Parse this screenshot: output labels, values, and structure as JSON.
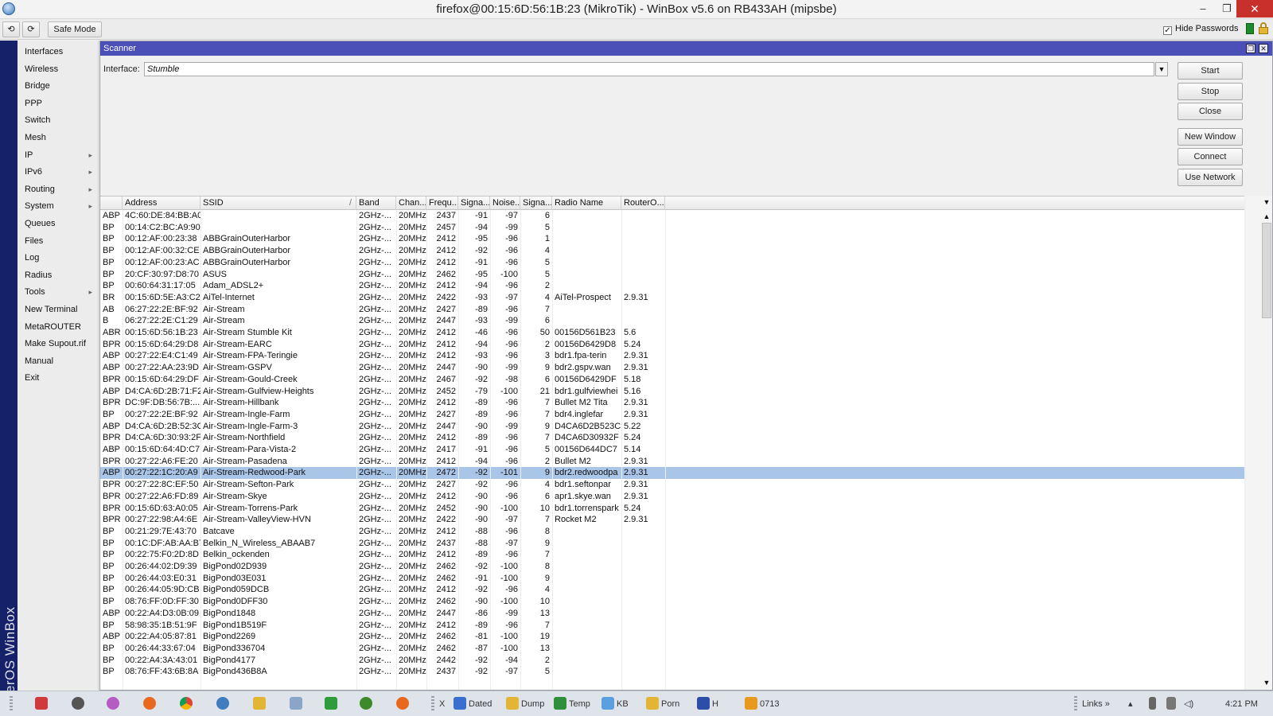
{
  "window": {
    "title": "firefox@00:15:6D:56:1B:23 (MikroTik) - WinBox v5.6 on RB433AH (mipsbe)",
    "minimize": "–",
    "restore": "❐",
    "close": "✕"
  },
  "toolbar": {
    "undo": "⟲",
    "redo": "⟳",
    "safe_mode": "Safe Mode",
    "hide_passwords_label": "Hide Passwords",
    "hide_passwords_checked": "✓"
  },
  "brand": "RouterOS WinBox",
  "sidebar": {
    "items": [
      {
        "label": "Interfaces",
        "arrow": ""
      },
      {
        "label": "Wireless",
        "arrow": ""
      },
      {
        "label": "Bridge",
        "arrow": ""
      },
      {
        "label": "PPP",
        "arrow": ""
      },
      {
        "label": "Switch",
        "arrow": ""
      },
      {
        "label": "Mesh",
        "arrow": ""
      },
      {
        "label": "IP",
        "arrow": "▸"
      },
      {
        "label": "IPv6",
        "arrow": "▸"
      },
      {
        "label": "Routing",
        "arrow": "▸"
      },
      {
        "label": "System",
        "arrow": "▸"
      },
      {
        "label": "Queues",
        "arrow": ""
      },
      {
        "label": "Files",
        "arrow": ""
      },
      {
        "label": "Log",
        "arrow": ""
      },
      {
        "label": "Radius",
        "arrow": ""
      },
      {
        "label": "Tools",
        "arrow": "▸"
      },
      {
        "label": "New Terminal",
        "arrow": ""
      },
      {
        "label": "MetaROUTER",
        "arrow": ""
      },
      {
        "label": "Make Supout.rif",
        "arrow": ""
      },
      {
        "label": "Manual",
        "arrow": ""
      },
      {
        "label": "Exit",
        "arrow": ""
      }
    ]
  },
  "scanner": {
    "title": "Scanner",
    "restore_btn": "❐",
    "close_btn": "✕",
    "interface_label": "Interface:",
    "interface_value": "Stumble",
    "interface_dropdown": "▼",
    "buttons": [
      "Start",
      "Stop",
      "Close",
      "New Window",
      "Connect",
      "Use Network"
    ],
    "columns": [
      "",
      "Address",
      "SSID",
      "Band",
      "Chan...",
      "Frequ...",
      "Signa...",
      "Noise...",
      "Signa...",
      "Radio Name",
      "RouterO..."
    ],
    "sort_indicator": "/",
    "rows": [
      [
        "ABP",
        "4C:60:DE:84:BB:A0",
        "",
        "2GHz-...",
        "20MHz",
        "2437",
        "-91",
        "-97",
        "6",
        "",
        ""
      ],
      [
        "BP",
        "00:14:C2:BC:A9:90",
        "",
        "2GHz-...",
        "20MHz",
        "2457",
        "-94",
        "-99",
        "5",
        "",
        ""
      ],
      [
        "BP",
        "00:12:AF:00:23:38",
        "ABBGrainOuterHarbor",
        "2GHz-...",
        "20MHz",
        "2412",
        "-95",
        "-96",
        "1",
        "",
        ""
      ],
      [
        "BP",
        "00:12:AF:00:32:CE",
        "ABBGrainOuterHarbor",
        "2GHz-...",
        "20MHz",
        "2412",
        "-92",
        "-96",
        "4",
        "",
        ""
      ],
      [
        "BP",
        "00:12:AF:00:23:AC",
        "ABBGrainOuterHarbor",
        "2GHz-...",
        "20MHz",
        "2412",
        "-91",
        "-96",
        "5",
        "",
        ""
      ],
      [
        "BP",
        "20:CF:30:97:D8:70",
        "ASUS",
        "2GHz-...",
        "20MHz",
        "2462",
        "-95",
        "-100",
        "5",
        "",
        ""
      ],
      [
        "BP",
        "00:60:64:31:17:05",
        "Adam_ADSL2+",
        "2GHz-...",
        "20MHz",
        "2412",
        "-94",
        "-96",
        "2",
        "",
        ""
      ],
      [
        "BR",
        "00:15:6D:5E:A3:C2",
        "AiTel-Internet",
        "2GHz-...",
        "20MHz",
        "2422",
        "-93",
        "-97",
        "4",
        "AiTel-Prospect",
        "2.9.31"
      ],
      [
        "AB",
        "06:27:22:2E:BF:92",
        "Air-Stream",
        "2GHz-...",
        "20MHz",
        "2427",
        "-89",
        "-96",
        "7",
        "",
        ""
      ],
      [
        "B",
        "06:27:22:2E:C1:29",
        "Air-Stream",
        "2GHz-...",
        "20MHz",
        "2447",
        "-93",
        "-99",
        "6",
        "",
        ""
      ],
      [
        "ABR",
        "00:15:6D:56:1B:23",
        "Air-Stream Stumble Kit",
        "2GHz-...",
        "20MHz",
        "2412",
        "-46",
        "-96",
        "50",
        "00156D561B23",
        "5.6"
      ],
      [
        "BPR",
        "00:15:6D:64:29:D8",
        "Air-Stream-EARC",
        "2GHz-...",
        "20MHz",
        "2412",
        "-94",
        "-96",
        "2",
        "00156D6429D8",
        "5.24"
      ],
      [
        "ABP",
        "00:27:22:E4:C1:49",
        "Air-Stream-FPA-Teringie",
        "2GHz-...",
        "20MHz",
        "2412",
        "-93",
        "-96",
        "3",
        "bdr1.fpa-terin",
        "2.9.31"
      ],
      [
        "ABP",
        "00:27:22:AA:23:9D",
        "Air-Stream-GSPV",
        "2GHz-...",
        "20MHz",
        "2447",
        "-90",
        "-99",
        "9",
        "bdr2.gspv.wan",
        "2.9.31"
      ],
      [
        "BPR",
        "00:15:6D:64:29:DF",
        "Air-Stream-Gould-Creek",
        "2GHz-...",
        "20MHz",
        "2467",
        "-92",
        "-98",
        "6",
        "00156D6429DF",
        "5.18"
      ],
      [
        "ABP",
        "D4:CA:6D:2B:71:F2",
        "Air-Stream-Gulfview-Heights",
        "2GHz-...",
        "20MHz",
        "2452",
        "-79",
        "-100",
        "21",
        "bdr1.gulfviewhei",
        "5.16"
      ],
      [
        "BPR",
        "DC:9F:DB:56:7B:...",
        "Air-Stream-Hillbank",
        "2GHz-...",
        "20MHz",
        "2412",
        "-89",
        "-96",
        "7",
        "Bullet M2 Tita",
        "2.9.31"
      ],
      [
        "BP",
        "00:27:22:2E:BF:92",
        "Air-Stream-Ingle-Farm",
        "2GHz-...",
        "20MHz",
        "2427",
        "-89",
        "-96",
        "7",
        "bdr4.inglefar",
        "2.9.31"
      ],
      [
        "ABP",
        "D4:CA:6D:2B:52:3C",
        "Air-Stream-Ingle-Farm-3",
        "2GHz-...",
        "20MHz",
        "2447",
        "-90",
        "-99",
        "9",
        "D4CA6D2B523C",
        "5.22"
      ],
      [
        "BPR",
        "D4:CA:6D:30:93:2F",
        "Air-Stream-Northfield",
        "2GHz-...",
        "20MHz",
        "2412",
        "-89",
        "-96",
        "7",
        "D4CA6D30932F",
        "5.24"
      ],
      [
        "ABP",
        "00:15:6D:64:4D:C7",
        "Air-Stream-Para-Vista-2",
        "2GHz-...",
        "20MHz",
        "2417",
        "-91",
        "-96",
        "5",
        "00156D644DC7",
        "5.14"
      ],
      [
        "BPR",
        "00:27:22:A6:FE:20",
        "Air-Stream-Pasadena",
        "2GHz-...",
        "20MHz",
        "2412",
        "-94",
        "-96",
        "2",
        "Bullet M2",
        "2.9.31"
      ],
      [
        "ABP",
        "00:27:22:1C:20:A9",
        "Air-Stream-Redwood-Park",
        "2GHz-...",
        "20MHz",
        "2472",
        "-92",
        "-101",
        "9",
        "bdr2.redwoodpa",
        "2.9.31"
      ],
      [
        "BPR",
        "00:27:22:8C:EF:50",
        "Air-Stream-Sefton-Park",
        "2GHz-...",
        "20MHz",
        "2427",
        "-92",
        "-96",
        "4",
        "bdr1.seftonpar",
        "2.9.31"
      ],
      [
        "BPR",
        "00:27:22:A6:FD:89",
        "Air-Stream-Skye",
        "2GHz-...",
        "20MHz",
        "2412",
        "-90",
        "-96",
        "6",
        "apr1.skye.wan",
        "2.9.31"
      ],
      [
        "BPR",
        "00:15:6D:63:A0:05",
        "Air-Stream-Torrens-Park",
        "2GHz-...",
        "20MHz",
        "2452",
        "-90",
        "-100",
        "10",
        "bdr1.torrenspark",
        "5.24"
      ],
      [
        "BPR",
        "00:27:22:98:A4:6E",
        "Air-Stream-ValleyView-HVN",
        "2GHz-...",
        "20MHz",
        "2422",
        "-90",
        "-97",
        "7",
        "Rocket M2",
        "2.9.31"
      ],
      [
        "BP",
        "00:21:29:7E:43:70",
        "Batcave",
        "2GHz-...",
        "20MHz",
        "2412",
        "-88",
        "-96",
        "8",
        "",
        ""
      ],
      [
        "BP",
        "00:1C:DF:AB:AA:B7",
        "Belkin_N_Wireless_ABAAB7",
        "2GHz-...",
        "20MHz",
        "2437",
        "-88",
        "-97",
        "9",
        "",
        ""
      ],
      [
        "BP",
        "00:22:75:F0:2D:8D",
        "Belkin_ockenden",
        "2GHz-...",
        "20MHz",
        "2412",
        "-89",
        "-96",
        "7",
        "",
        ""
      ],
      [
        "BP",
        "00:26:44:02:D9:39",
        "BigPond02D939",
        "2GHz-...",
        "20MHz",
        "2462",
        "-92",
        "-100",
        "8",
        "",
        ""
      ],
      [
        "BP",
        "00:26:44:03:E0:31",
        "BigPond03E031",
        "2GHz-...",
        "20MHz",
        "2462",
        "-91",
        "-100",
        "9",
        "",
        ""
      ],
      [
        "BP",
        "00:26:44:05:9D:CB",
        "BigPond059DCB",
        "2GHz-...",
        "20MHz",
        "2412",
        "-92",
        "-96",
        "4",
        "",
        ""
      ],
      [
        "BP",
        "08:76:FF:0D:FF:30",
        "BigPond0DFF30",
        "2GHz-...",
        "20MHz",
        "2462",
        "-90",
        "-100",
        "10",
        "",
        ""
      ],
      [
        "ABP",
        "00:22:A4:D3:0B:09",
        "BigPond1848",
        "2GHz-...",
        "20MHz",
        "2447",
        "-86",
        "-99",
        "13",
        "",
        ""
      ],
      [
        "BP",
        "58:98:35:1B:51:9F",
        "BigPond1B519F",
        "2GHz-...",
        "20MHz",
        "2412",
        "-89",
        "-96",
        "7",
        "",
        ""
      ],
      [
        "ABP",
        "00:22:A4:05:87:81",
        "BigPond2269",
        "2GHz-...",
        "20MHz",
        "2462",
        "-81",
        "-100",
        "19",
        "",
        ""
      ],
      [
        "BP",
        "00:26:44:33:67:04",
        "BigPond336704",
        "2GHz-...",
        "20MHz",
        "2462",
        "-87",
        "-100",
        "13",
        "",
        ""
      ],
      [
        "BP",
        "00:22:A4:3A:43:01",
        "BigPond4177",
        "2GHz-...",
        "20MHz",
        "2442",
        "-92",
        "-94",
        "2",
        "",
        ""
      ],
      [
        "BP",
        "08:76:FF:43:6B:8A",
        "BigPond436B8A",
        "2GHz-...",
        "20MHz",
        "2437",
        "-92",
        "-97",
        "5",
        "",
        ""
      ]
    ],
    "selected_row": 22
  },
  "taskbar": {
    "items": [
      {
        "name": "dated-folder",
        "label": "Dated",
        "color": "#3a6fd0"
      },
      {
        "name": "dump-folder",
        "label": "Dump",
        "color": "#e2b634"
      },
      {
        "name": "temp-folder",
        "label": "Temp",
        "color": "#2f8f3a"
      },
      {
        "name": "kb-folder",
        "label": "KB",
        "color": "#5aa0e0"
      },
      {
        "name": "porn-folder",
        "label": "Porn",
        "color": "#e2b634"
      },
      {
        "name": "h-folder",
        "label": "H",
        "color": "#2b4fa8"
      },
      {
        "name": "star-0713",
        "label": "0713",
        "color": "#e89a1e"
      }
    ],
    "x_label": "X",
    "links_label": "Links",
    "links_chevron": "»",
    "clock": "4:21 PM"
  },
  "colors": {
    "scanner_titlebar": "#4a50b8",
    "selected_row": "#a9c5e8",
    "brand_strip": "#15226a",
    "close_button": "#c7302b"
  }
}
